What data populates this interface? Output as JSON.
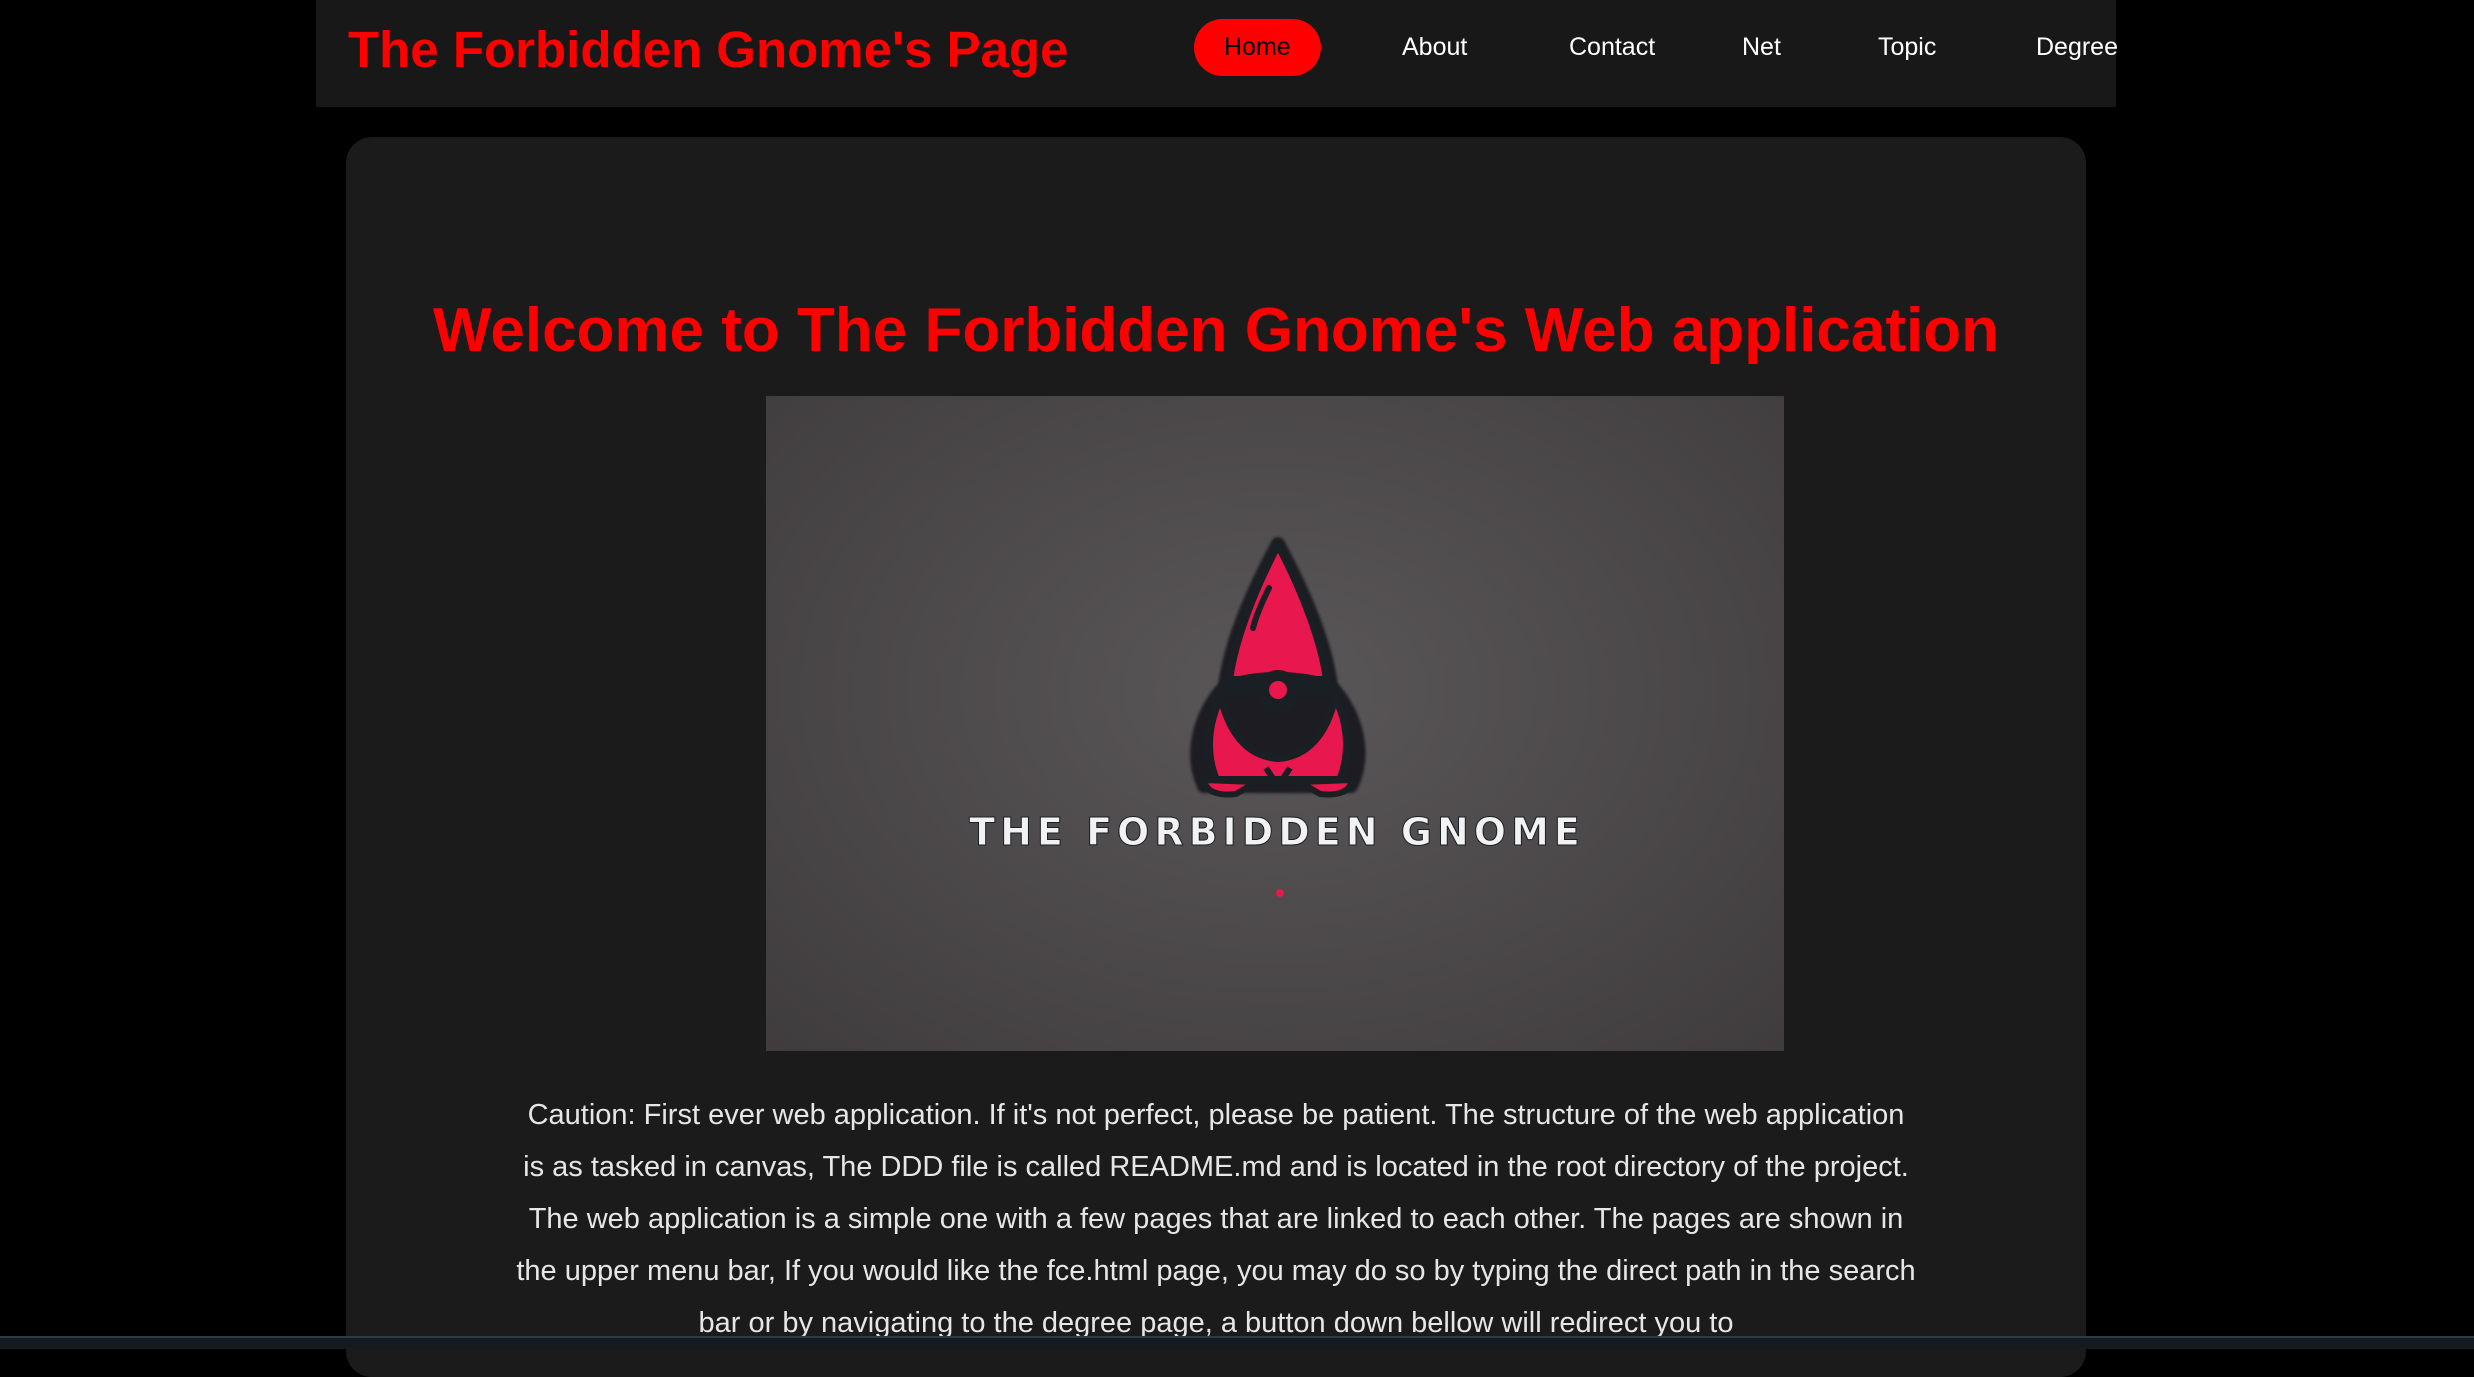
{
  "header": {
    "site_title": "The Forbidden Gnome's Page",
    "nav": [
      {
        "label": "Home",
        "active": true
      },
      {
        "label": "About",
        "active": false
      },
      {
        "label": "Contact",
        "active": false
      },
      {
        "label": "Net",
        "active": false
      },
      {
        "label": "Topic",
        "active": false
      },
      {
        "label": "Degree",
        "active": false
      }
    ]
  },
  "main": {
    "heading": "Welcome to The Forbidden Gnome's Web application",
    "logo": {
      "icon": "gnome-icon",
      "wordmark": "THE FORBIDDEN GNOME"
    },
    "caution_text": "Caution: First ever web application. If it's not perfect, please be patient. The structure of the web application is as tasked in canvas, The DDD file is called README.md and is located in the root directory of the project. The web application is a simple one with a few pages that are linked to each other. The pages are shown in the upper menu bar, If you would like the fce.html page, you may do so by typing the direct path in the search bar or by navigating to the degree page, a button down bellow will redirect you to"
  },
  "colors": {
    "accent": "#ff0000",
    "background": "#000000",
    "header_bg": "#181818",
    "card_bg": "#1b1b1b",
    "gnome": "#e8174d"
  }
}
